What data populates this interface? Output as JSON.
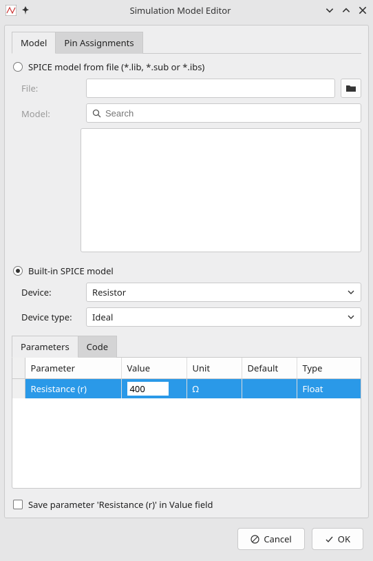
{
  "window": {
    "title": "Simulation Model Editor"
  },
  "tabs": {
    "model": "Model",
    "pin_assignments": "Pin Assignments"
  },
  "spice_file": {
    "label": "SPICE model from file (*.lib, *.sub or *.ibs)",
    "file_label": "File:",
    "file_value": "",
    "model_label": "Model:",
    "search_placeholder": "Search"
  },
  "builtin": {
    "label": "Built-in SPICE model",
    "device_label": "Device:",
    "device_value": "Resistor",
    "device_type_label": "Device type:",
    "device_type_value": "Ideal"
  },
  "subtabs": {
    "parameters": "Parameters",
    "code": "Code"
  },
  "params_table": {
    "headers": {
      "parameter": "Parameter",
      "value": "Value",
      "unit": "Unit",
      "default": "Default",
      "type": "Type"
    },
    "rows": [
      {
        "parameter": "Resistance (r)",
        "value": "400",
        "unit": "Ω",
        "default": "",
        "type": "Float"
      }
    ]
  },
  "save_param_label": "Save parameter 'Resistance (r)' in Value field",
  "buttons": {
    "cancel": "Cancel",
    "ok": "OK"
  }
}
